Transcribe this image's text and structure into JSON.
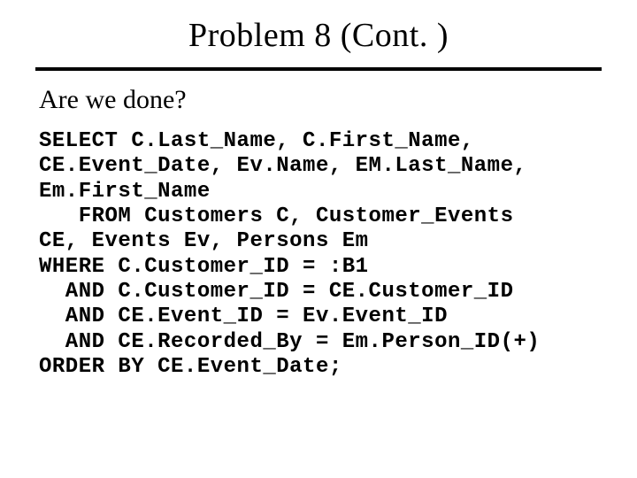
{
  "title": "Problem 8 (Cont. )",
  "question": "Are we done?",
  "code": "SELECT C.Last_Name, C.First_Name,\nCE.Event_Date, Ev.Name, EM.Last_Name,\nEm.First_Name\n   FROM Customers C, Customer_Events\nCE, Events Ev, Persons Em\nWHERE C.Customer_ID = :B1\n  AND C.Customer_ID = CE.Customer_ID\n  AND CE.Event_ID = Ev.Event_ID\n  AND CE.Recorded_By = Em.Person_ID(+)\nORDER BY CE.Event_Date;"
}
